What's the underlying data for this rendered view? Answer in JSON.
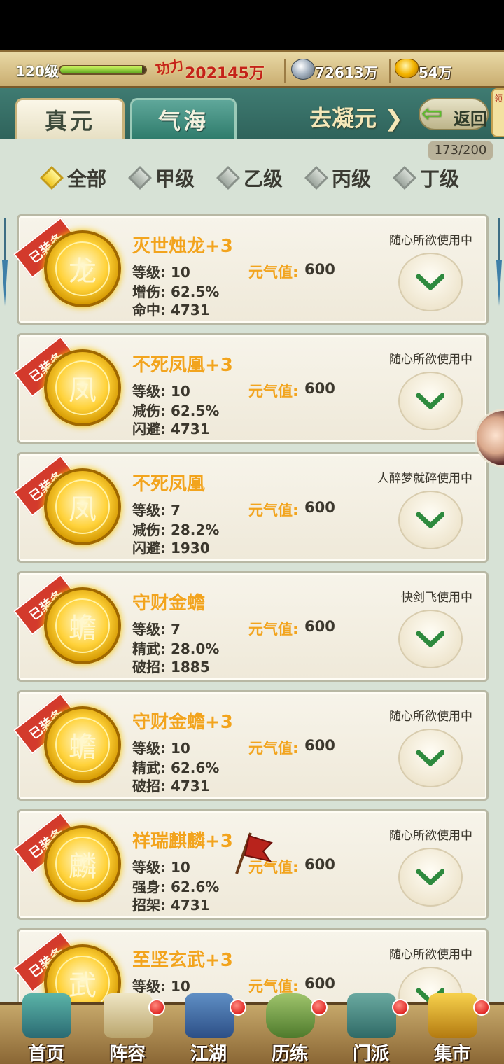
{
  "header": {
    "level": "120级",
    "xp_fraction": 0.96,
    "power_label": "功力",
    "power_value": "202145万",
    "silver_value": "72613万",
    "gold_value": "54万"
  },
  "tabs": {
    "active": "真元",
    "inactive": "气海",
    "goto_label": "去凝元",
    "back_label": "返回",
    "side_tab_label": "领"
  },
  "count": "173/200",
  "filters": [
    "全部",
    "甲级",
    "乙级",
    "丙级",
    "丁级"
  ],
  "equipped_label": "已装备",
  "yq_label": "元气值:",
  "items": [
    {
      "name": "灭世烛龙+3",
      "level": "等级: 10",
      "stat1": "增伤: 62.5%",
      "stat2": "命中: 4731",
      "yq": "600",
      "user": "随心所欲使用中",
      "glyph": "龙"
    },
    {
      "name": "不死凤凰+3",
      "level": "等级: 10",
      "stat1": "减伤: 62.5%",
      "stat2": "闪避: 4731",
      "yq": "600",
      "user": "随心所欲使用中",
      "glyph": "凤"
    },
    {
      "name": "不死凤凰",
      "level": "等级: 7",
      "stat1": "减伤: 28.2%",
      "stat2": "闪避: 1930",
      "yq": "600",
      "user": "人醉梦就碎使用中",
      "glyph": "凤"
    },
    {
      "name": "守财金蟾",
      "level": "等级: 7",
      "stat1": "精武: 28.0%",
      "stat2": "破招: 1885",
      "yq": "600",
      "user": "快剑飞使用中",
      "glyph": "蟾"
    },
    {
      "name": "守财金蟾+3",
      "level": "等级: 10",
      "stat1": "精武: 62.6%",
      "stat2": "破招: 4731",
      "yq": "600",
      "user": "随心所欲使用中",
      "glyph": "蟾"
    },
    {
      "name": "祥瑞麒麟+3",
      "level": "等级: 10",
      "stat1": "强身: 62.6%",
      "stat2": "招架: 4731",
      "yq": "600",
      "user": "随心所欲使用中",
      "glyph": "麟"
    },
    {
      "name": "至坚玄武+3",
      "level": "等级: 10",
      "stat1": "",
      "stat2": "",
      "yq": "600",
      "user": "随心所欲使用中",
      "glyph": "武"
    }
  ],
  "bottom_nav": [
    "首页",
    "阵容",
    "江湖",
    "历练",
    "门派",
    "集市"
  ],
  "colors": {
    "accent_gold": "#f2a41e",
    "ribbon_red": "#d33a2c",
    "tab_green": "#2f7c6c",
    "chevron_green": "#2e8a3e"
  }
}
